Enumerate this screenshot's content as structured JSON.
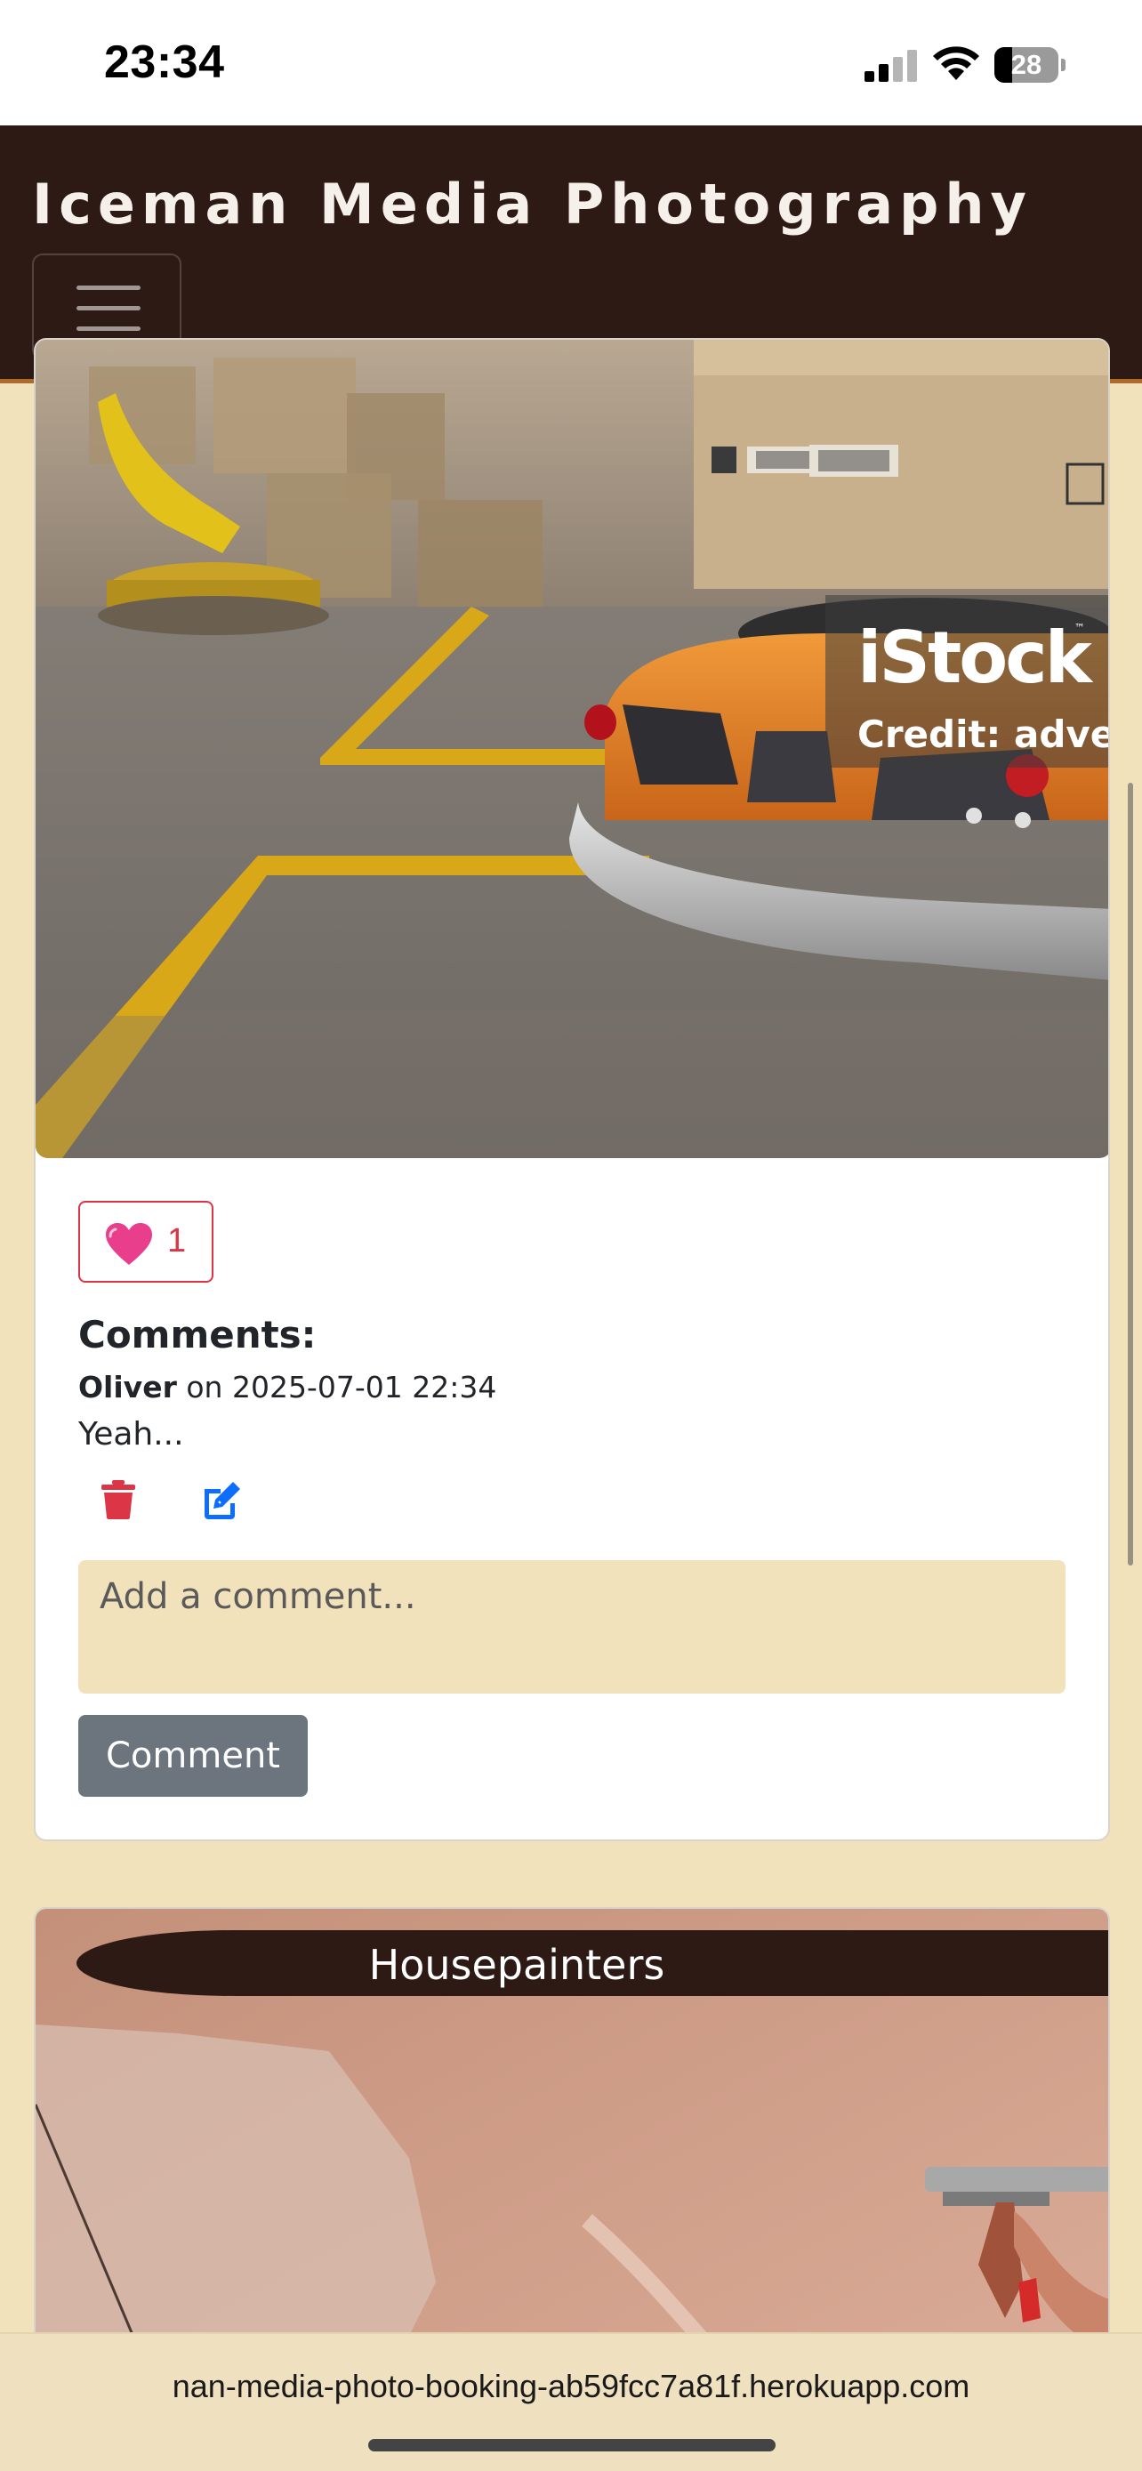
{
  "status_bar": {
    "time": "23:34",
    "battery": "28",
    "battery_level": 0.28
  },
  "navbar": {
    "brand": "Iceman Media Photography",
    "toggler_icon": "hamburger-icon"
  },
  "post_1": {
    "image_watermark": {
      "brand": "iStock",
      "tm": "™",
      "credit": "Credit: adve"
    },
    "likes": {
      "icon": "heart-icon",
      "count": "1"
    },
    "comments_title": "Comments:",
    "comments": [
      {
        "author": "Oliver",
        "on": "on",
        "date": "2025-07-01 22:34",
        "text": "Yeah..."
      }
    ],
    "comment_input": {
      "placeholder": "Add a comment..."
    },
    "comment_button": "Comment"
  },
  "post_2": {
    "title": "Housepainters"
  },
  "browser": {
    "url": "nan-media-photo-booking-ab59fcc7a81f.herokuapp.com"
  },
  "colors": {
    "navbar": "#2d1a14",
    "page_bg": "#f2e2bb",
    "accent": "#b06a2c",
    "danger": "#dc3545",
    "primary": "#0d6efd",
    "secondary": "#6c757d"
  }
}
